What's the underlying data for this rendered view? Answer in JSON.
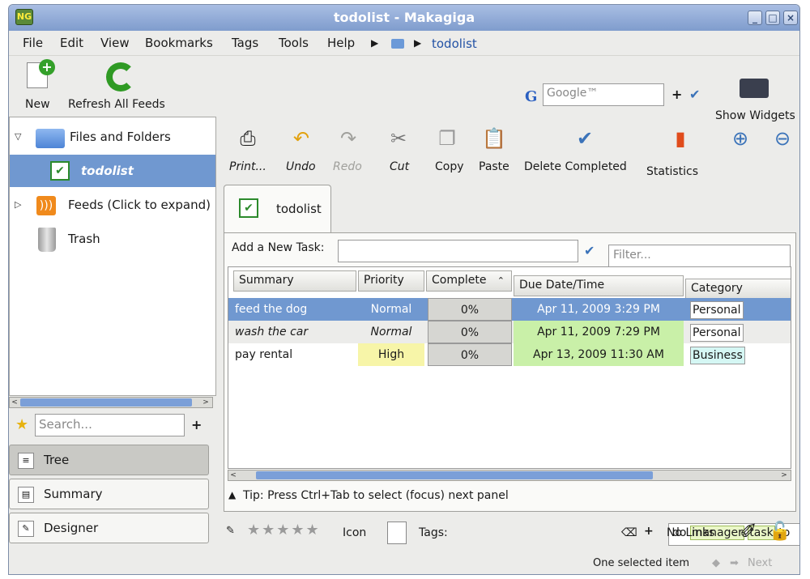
{
  "window": {
    "title": "todolist - Makagiga",
    "app_icon_text": "NG",
    "btn_minimize": "_",
    "btn_maximize": "□",
    "btn_close": "×"
  },
  "menu": {
    "items": [
      "File",
      "Edit",
      "View",
      "Bookmarks",
      "Tags",
      "Tools",
      "Help"
    ],
    "breadcrumb_arrow": "▶",
    "breadcrumb_current": "todolist"
  },
  "main_toolbar": {
    "new_label": "New",
    "refresh_label": "Refresh All Feeds",
    "search_engine_glyph": "G",
    "search_placeholder": "Google™",
    "search_add": "+",
    "search_go": "✔",
    "widgets_label": "Show Widgets"
  },
  "tree": {
    "expand_open": "▽",
    "expand_closed": "▷",
    "files_and_folders": "Files and Folders",
    "todolist": "todolist",
    "feeds": "Feeds  (Click to expand)",
    "trash": "Trash",
    "rss_glyph": ")))",
    "check_glyph": "✔"
  },
  "left_bottom": {
    "star_glyph": "★",
    "search_placeholder": "Search...",
    "add": "+",
    "tabs": [
      {
        "label": "Tree",
        "glyph": "≡"
      },
      {
        "label": "Summary",
        "glyph": "▤"
      },
      {
        "label": "Designer",
        "glyph": "✎"
      }
    ]
  },
  "scroll": {
    "left": "<",
    "right": ">",
    "grip": "III"
  },
  "edit_toolbar": {
    "items": [
      {
        "label": "Print...",
        "glyph": "⎙"
      },
      {
        "label": "Undo",
        "glyph": "↶"
      },
      {
        "label": "Redo",
        "glyph": "↷"
      },
      {
        "label": "Cut",
        "glyph": "✂"
      },
      {
        "label": "Copy",
        "glyph": "❐"
      },
      {
        "label": "Paste",
        "glyph": "📋"
      },
      {
        "label": "Delete Completed",
        "glyph": "✔"
      },
      {
        "label": "Statistics",
        "glyph": "▮"
      },
      {
        "label": "",
        "glyph": "⊕"
      },
      {
        "label": "",
        "glyph": "⊖"
      }
    ]
  },
  "tab": {
    "label": "todolist",
    "check_glyph": "✔"
  },
  "task_panel": {
    "add_label": "Add a New Task:",
    "add_confirm": "✔",
    "filter_placeholder": "Filter...",
    "columns": [
      "Summary",
      "Priority",
      "Complete",
      "Due Date/Time",
      "Category"
    ],
    "sort_indicator": "⌃",
    "rows": [
      {
        "summary": "feed the dog",
        "priority": "Normal",
        "complete": "0%",
        "due": "Apr 11, 2009 3:29 PM",
        "category": "Personal"
      },
      {
        "summary": "wash the car",
        "priority": "Normal",
        "complete": "0%",
        "due": "Apr 11, 2009 7:29 PM",
        "category": "Personal"
      },
      {
        "summary": "pay rental",
        "priority": "High",
        "complete": "0%",
        "due": "Apr 13, 2009 11:30 AM",
        "category": "Business"
      }
    ],
    "tip_arrow": "▲",
    "tip": "Tip: Press Ctrl+Tab to select (focus) next panel"
  },
  "bottom": {
    "edit_glyph": "✎",
    "stars": "★★★★★",
    "icon_label": "Icon",
    "tags_label": "Tags:",
    "tags": [
      "do",
      "manager",
      "task",
      "to"
    ],
    "clear_glyph": "⌫",
    "add_glyph": "+",
    "links_label": "No Links",
    "note_glyph": "✐",
    "lock_glyph": "🔓"
  },
  "status": {
    "text": "One selected item",
    "prev": "◆",
    "next_glyph": "➡",
    "next_label": "Next"
  },
  "colors": {
    "selection": "#7098d0",
    "high_priority": "#f7f5a8",
    "due_green": "#c9f0a8",
    "business": "#d5f7f4"
  }
}
